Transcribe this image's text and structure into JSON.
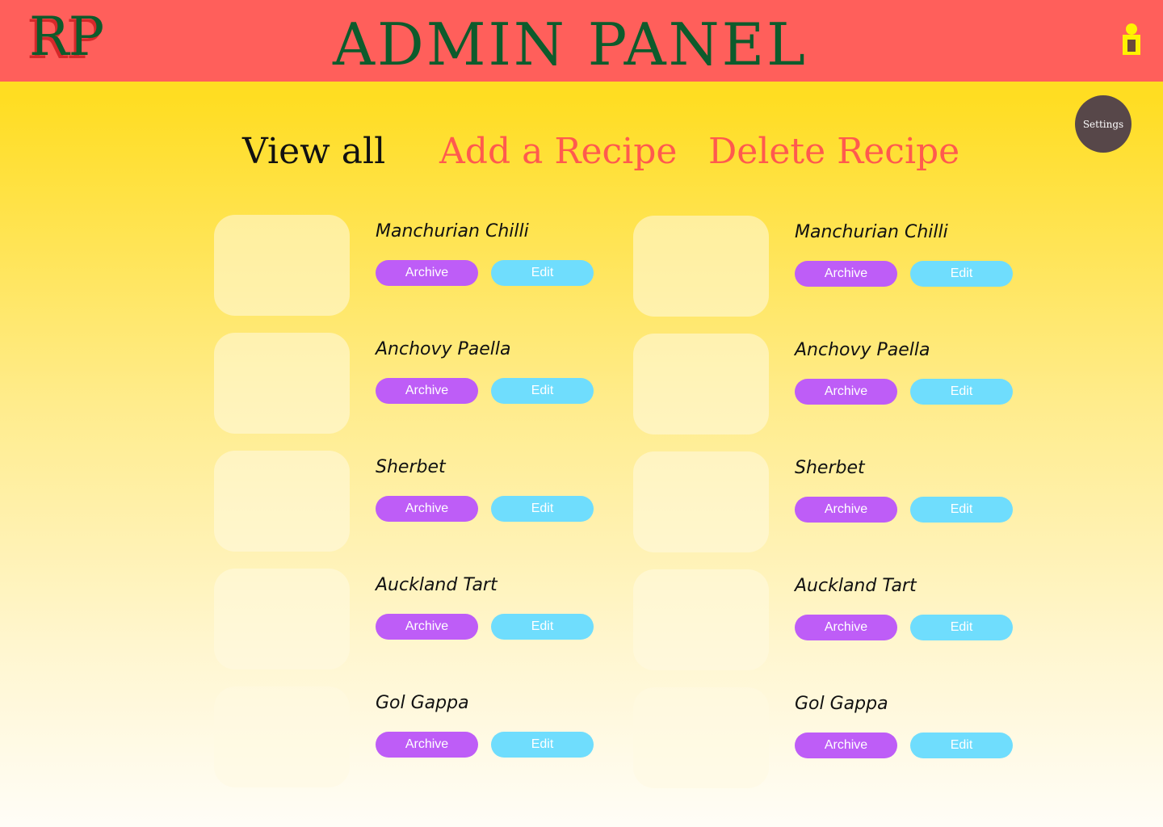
{
  "header": {
    "logo": "RP",
    "title": "ADMIN PANEL"
  },
  "settings_label": "Settings",
  "tabs": {
    "view_all": "View all",
    "add": "Add a Recipe",
    "delete": "Delete Recipe"
  },
  "button_labels": {
    "archive": "Archive",
    "edit": "Edit"
  },
  "recipes": {
    "left": [
      {
        "name": "Manchurian Chilli"
      },
      {
        "name": "Anchovy Paella"
      },
      {
        "name": "Sherbet"
      },
      {
        "name": "Auckland Tart"
      },
      {
        "name": "Gol Gappa"
      }
    ],
    "right": [
      {
        "name": "Manchurian Chilli"
      },
      {
        "name": "Anchovy Paella"
      },
      {
        "name": "Sherbet"
      },
      {
        "name": "Auckland Tart"
      },
      {
        "name": "Gol Gappa"
      }
    ]
  },
  "colors": {
    "header_bg": "#FF5F5B",
    "brand_green": "#0D5B2C",
    "archive": "#BE5DF7",
    "edit": "#6FDDFD",
    "settings_bg": "#574749",
    "tab_active": "#111111",
    "tab_inactive": "#FF5A4E"
  },
  "icons": {
    "user": "user-icon"
  }
}
